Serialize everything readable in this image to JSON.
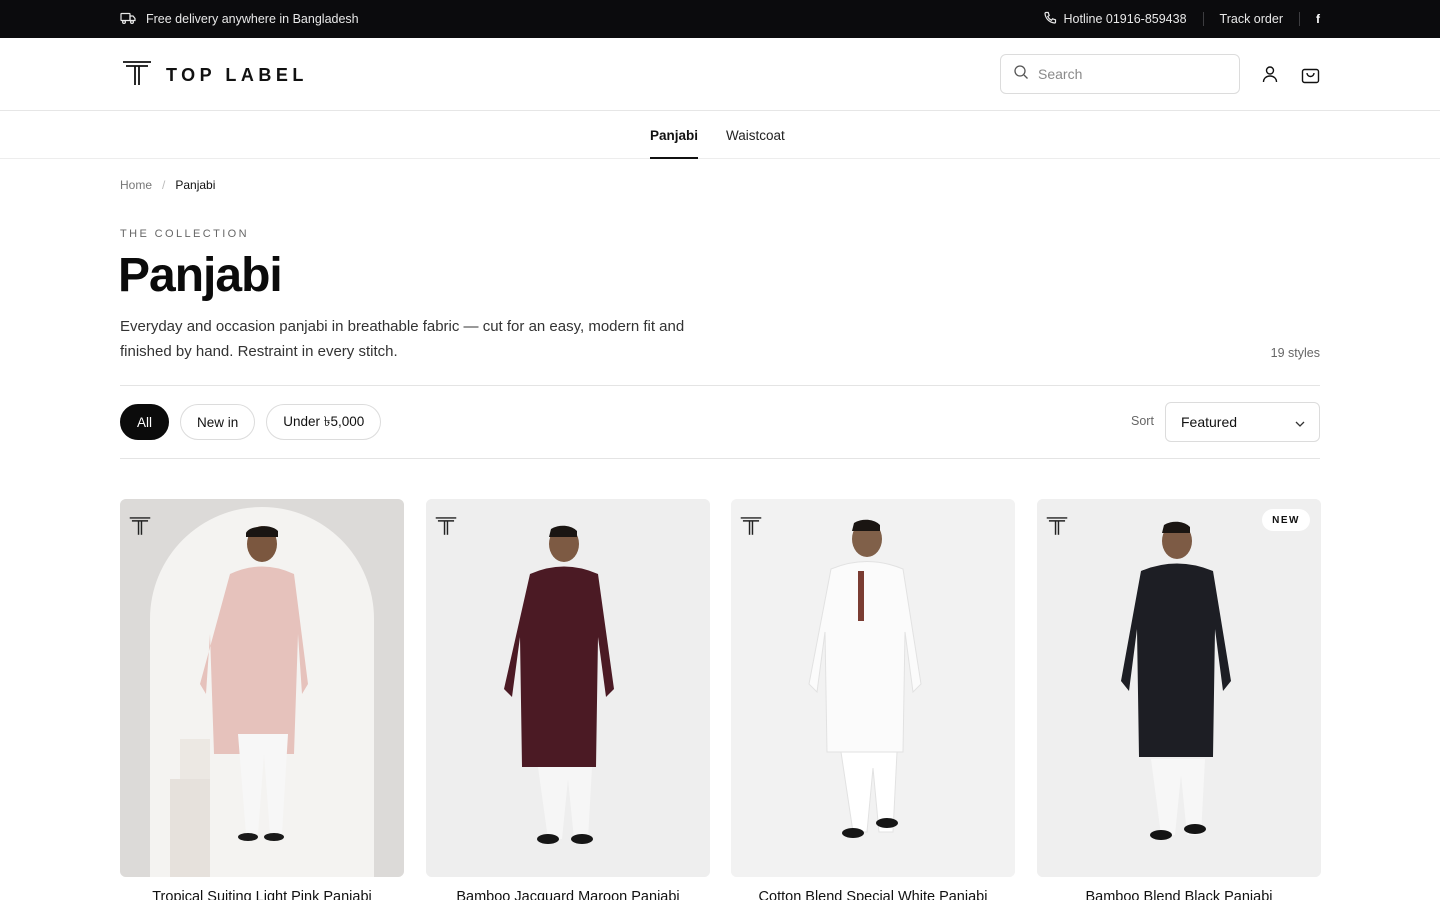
{
  "announcement": {
    "delivery_text": "Free delivery anywhere in Bangladesh",
    "hotline_text": "Hotline 01916-859438",
    "track_order": "Track order",
    "social_label": "f"
  },
  "header": {
    "brand": "TOP LABEL",
    "search_placeholder": "Search"
  },
  "nav": {
    "tabs": [
      {
        "label": "Panjabi",
        "active": true
      },
      {
        "label": "Waistcoat",
        "active": false
      }
    ]
  },
  "breadcrumb": {
    "home": "Home",
    "separator": "/",
    "current": "Panjabi"
  },
  "collection": {
    "eyebrow": "THE COLLECTION",
    "title": "Panjabi",
    "description": "Everyday and occasion panjabi in breathable fabric — cut for an easy, modern fit and finished by hand. Restraint in every stitch.",
    "count": "19 styles"
  },
  "filters": {
    "chips": [
      {
        "label": "All",
        "active": true
      },
      {
        "label": "New in",
        "active": false
      },
      {
        "label": "Under ৳5,000",
        "active": false
      }
    ],
    "sort_label": "Sort",
    "sort_value": "Featured"
  },
  "products": [
    {
      "name": "Tropical Suiting Light Pink Panjabi",
      "badge": "",
      "color": "#e5c3bd"
    },
    {
      "name": "Bamboo Jacquard Maroon Panjabi",
      "badge": "",
      "color": "#4a1a23"
    },
    {
      "name": "Cotton Blend Special White Panjabi",
      "badge": "",
      "color": "#f5f5f4"
    },
    {
      "name": "Bamboo Blend Black Panjabi",
      "badge": "NEW",
      "color": "#1c1d22"
    }
  ]
}
